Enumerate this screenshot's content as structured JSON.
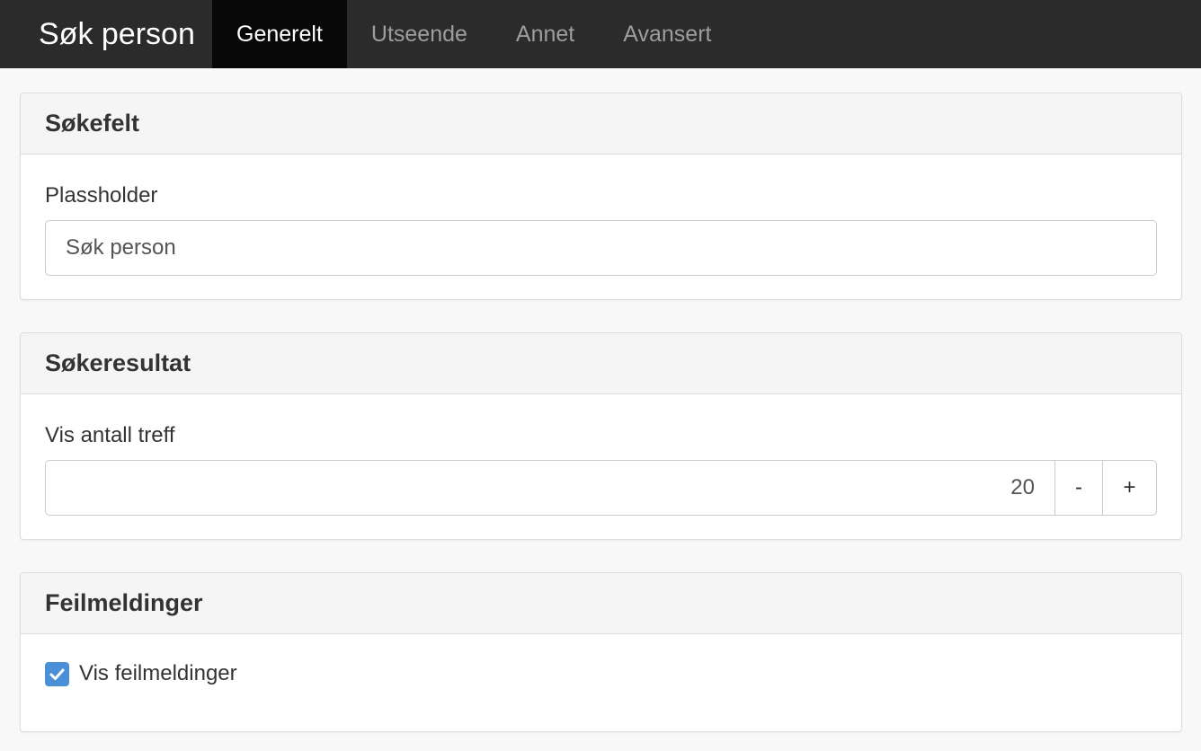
{
  "app": {
    "title": "Søk person"
  },
  "nav": {
    "tabs": [
      {
        "label": "Generelt",
        "active": true
      },
      {
        "label": "Utseende",
        "active": false
      },
      {
        "label": "Annet",
        "active": false
      },
      {
        "label": "Avansert",
        "active": false
      }
    ]
  },
  "sections": {
    "sokefelt": {
      "heading": "Søkefelt",
      "placeholder_label": "Plassholder",
      "placeholder_value": "Søk person"
    },
    "sokeresultat": {
      "heading": "Søkeresultat",
      "count_label": "Vis antall treff",
      "count_value": "20",
      "decrement_label": "-",
      "increment_label": "+"
    },
    "feilmeldinger": {
      "heading": "Feilmeldinger",
      "show_errors_label": "Vis feilmeldinger",
      "show_errors_checked": true
    }
  },
  "colors": {
    "navbar_bg": "#2b2b2b",
    "active_tab_bg": "#080808",
    "checkbox_accent": "#4a90d9"
  },
  "icons": {
    "checkmark": "check-icon"
  }
}
